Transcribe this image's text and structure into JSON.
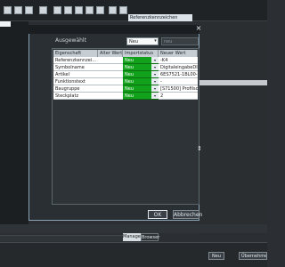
{
  "top_toolbar": {
    "reference_tab_label": "Referenzkennzeichen"
  },
  "dialog": {
    "close_label": "×",
    "ausgewaehlt_label": "Ausgewählt",
    "select_value": "Neu",
    "select_arrow": "▾",
    "disabled_field_value": "neu",
    "columns": [
      "Eigenschaft",
      "Alter Wert",
      "Importstatus",
      "Neuer Wert"
    ],
    "rows": [
      {
        "name": "Referenzkennzei...",
        "old": "",
        "status": "Neu",
        "arrow": "▾",
        "new": "-K4"
      },
      {
        "name": "Symbolname",
        "old": "",
        "status": "Neu",
        "arrow": "▾",
        "new": "DigitaleingabeDI32x..."
      },
      {
        "name": "Artikel",
        "old": "",
        "status": "Neu",
        "arrow": "▾",
        "new": "6ES7521-1BL00-0AB0"
      },
      {
        "name": "Funktionstext",
        "old": "",
        "status": "Neu",
        "arrow": "▾",
        "new": "-"
      },
      {
        "name": "Baugruppe",
        "old": "",
        "status": "Neu",
        "arrow": "▾",
        "new": "[S71500] Profilschie..."
      },
      {
        "name": "Steckplatz",
        "old": "",
        "status": "Neu",
        "arrow": "▾",
        "new": "2"
      }
    ],
    "ok_label": "OK",
    "cancel_label": "Abbrechen"
  },
  "bottom_tabs": {
    "manager": "Manager",
    "browser": "Browser"
  },
  "footer": {
    "neu_label": "Neu",
    "uebernehmen_label": "Übernehmen"
  },
  "colors": {
    "status_green": "#11a11a",
    "dialog_bg": "#2a2f33"
  }
}
